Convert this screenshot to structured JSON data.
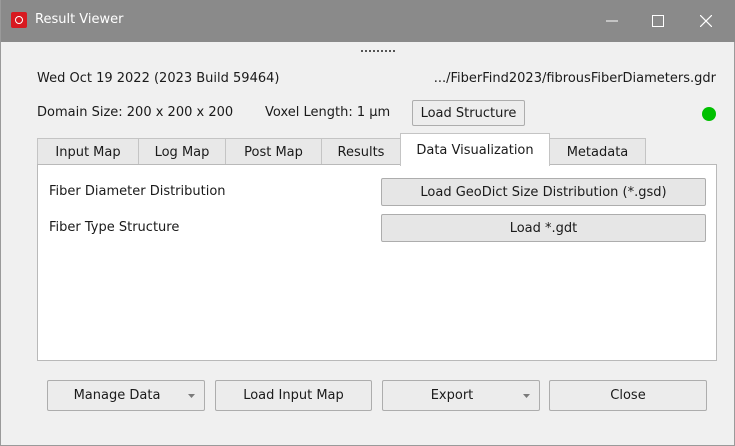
{
  "window": {
    "title": "Result Viewer",
    "icon": "app-logo-icon",
    "controls": [
      "minimize-icon",
      "maximize-icon",
      "close-icon"
    ]
  },
  "info": {
    "date_build": "Wed Oct 19 2022 (2023 Build 59464)",
    "file_path": ".../FiberFind2023/fibrousFiberDiameters.gdr",
    "domain_size": "Domain Size: 200 x 200 x 200",
    "voxel_length": "Voxel Length: 1 µm",
    "load_structure_label": "Load Structure",
    "status_color": "#00c000"
  },
  "tabs": [
    {
      "label": "Input Map"
    },
    {
      "label": "Log Map"
    },
    {
      "label": "Post Map"
    },
    {
      "label": "Results"
    },
    {
      "label": "Data Visualization",
      "active": true
    },
    {
      "label": "Metadata"
    }
  ],
  "data_visualization": {
    "rows": [
      {
        "label": "Fiber Diameter Distribution",
        "button": "Load GeoDict Size Distribution (*.gsd)"
      },
      {
        "label": "Fiber Type Structure",
        "button": "Load *.gdt"
      }
    ]
  },
  "footer": {
    "manage_data": "Manage Data",
    "load_input_map": "Load Input Map",
    "export": "Export",
    "close": "Close"
  }
}
